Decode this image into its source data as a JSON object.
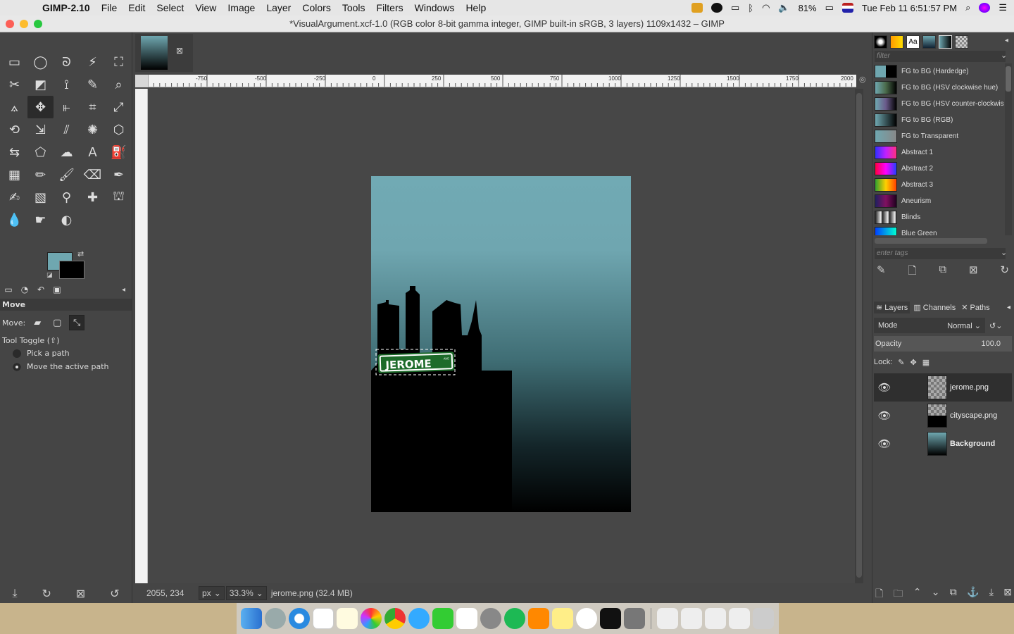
{
  "menubar": {
    "app_name": "GIMP-2.10",
    "menus": [
      "File",
      "Edit",
      "Select",
      "View",
      "Image",
      "Layer",
      "Colors",
      "Tools",
      "Filters",
      "Windows",
      "Help"
    ],
    "battery": "81%",
    "clock": "Tue Feb 11  6:51:57 PM"
  },
  "window": {
    "title": "*VisualArgument.xcf-1.0 (RGB color 8-bit gamma integer, GIMP built-in sRGB, 3 layers) 1109x1432 – GIMP"
  },
  "colors": {
    "foreground": "#6fa7b0",
    "background": "#000000",
    "sign_green": "#1d6b2a"
  },
  "tool_options": {
    "title": "Move",
    "move_label": "Move:",
    "toggle_label": "Tool Toggle  (⇧)",
    "option_pick": "Pick a path",
    "option_move": "Move the active path"
  },
  "ruler": {
    "h_ticks": [
      "-750",
      "-500",
      "-250",
      "0",
      "250",
      "500",
      "750",
      "1000",
      "1250",
      "1500",
      "1750",
      "2000"
    ]
  },
  "canvas": {
    "sign_text": "JEROME",
    "sign_suffix": "AVE"
  },
  "statusbar": {
    "coords": "2055, 234",
    "unit": "px",
    "zoom": "33.3%",
    "message": "jerome.png (32.4 MB)"
  },
  "gradients": {
    "filter_placeholder": "filter",
    "tags_placeholder": "enter tags",
    "items": [
      {
        "name": "FG to BG (Hardedge)",
        "swatch": "linear-gradient(90deg,#6fa7b0 50%,#000 50%)"
      },
      {
        "name": "FG to BG (HSV clockwise hue)",
        "swatch": "linear-gradient(90deg,#6fa7b0,#4a6a4a,#000)"
      },
      {
        "name": "FG to BG (HSV counter-clockwise)",
        "swatch": "linear-gradient(90deg,#6fa7b0,#6a5a8a,#000)"
      },
      {
        "name": "FG to BG (RGB)",
        "swatch": "linear-gradient(90deg,#6fa7b0,#000)"
      },
      {
        "name": "FG to Transparent",
        "swatch": "linear-gradient(90deg,#6fa7b0,#888)"
      },
      {
        "name": "Abstract 1",
        "swatch": "linear-gradient(90deg,#3030ff,#c020ff,#ff3080)"
      },
      {
        "name": "Abstract 2",
        "swatch": "linear-gradient(90deg,#ff0040,#ff00ff,#2040ff)"
      },
      {
        "name": "Abstract 3",
        "swatch": "linear-gradient(90deg,#30a030,#ffd000,#ff4000)"
      },
      {
        "name": "Aneurism",
        "swatch": "linear-gradient(90deg,#202060,#801060,#200020)"
      },
      {
        "name": "Blinds",
        "swatch": "repeating-linear-gradient(90deg,#222 0,#eee 8px,#222 10px)"
      },
      {
        "name": "Blue Green",
        "swatch": "linear-gradient(90deg,#0040ff,#00ffd0)"
      }
    ]
  },
  "layers_panel": {
    "tabs": [
      "Layers",
      "Channels",
      "Paths"
    ],
    "mode_label": "Mode",
    "mode_value": "Normal",
    "opacity_label": "Opacity",
    "opacity_value": "100.0",
    "lock_label": "Lock:",
    "layers": [
      {
        "name": "jerome.png",
        "selected": true
      },
      {
        "name": "cityscape.png",
        "selected": false
      },
      {
        "name": "Background",
        "selected": false
      }
    ]
  }
}
